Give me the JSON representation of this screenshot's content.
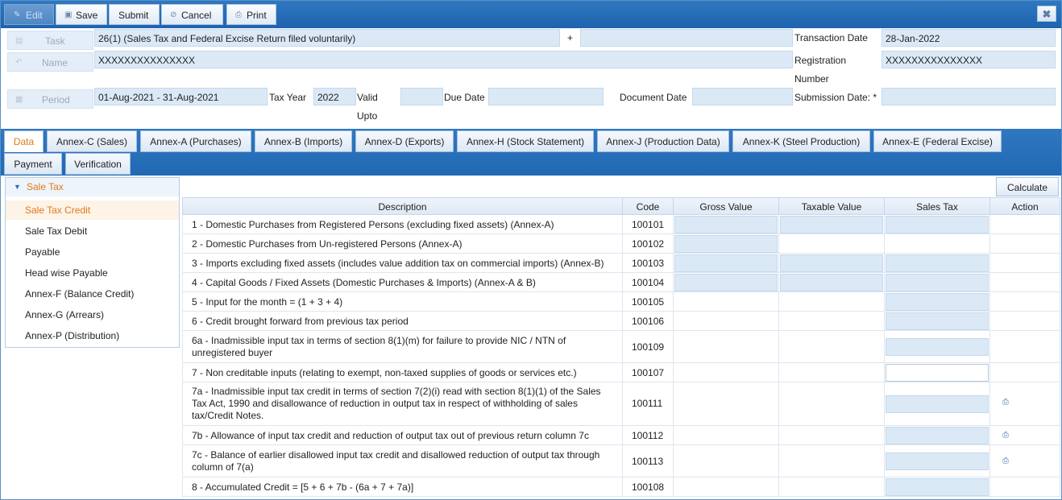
{
  "toolbar": {
    "edit_label": "Edit",
    "save_label": "Save",
    "submit_label": "Submit",
    "cancel_label": "Cancel",
    "print_label": "Print",
    "close_glyph": "✖"
  },
  "header": {
    "task_label": "Task",
    "task_value": "26(1) (Sales Tax and Federal Excise Return filed voluntarily)",
    "plus_glyph": "+",
    "name_label": "Name",
    "name_value": "XXXXXXXXXXXXXXX",
    "period_label": "Period",
    "period_value": "01-Aug-2021 -  31-Aug-2021",
    "tax_year_label": "Tax Year",
    "tax_year_value": "2022",
    "valid_label_line1": "Valid",
    "valid_label_line2": "Upto",
    "due_date_label": "Due Date",
    "document_date_label": "Document Date",
    "transaction_date_label": "Transaction Date",
    "transaction_date_value": "28-Jan-2022",
    "registration_label_line1": "Registration",
    "registration_label_line2": "Number",
    "registration_value": "XXXXXXXXXXXXXXX",
    "submission_date_label": "Submission Date: *"
  },
  "tabs_row1": [
    "Data",
    "Annex-C (Sales)",
    "Annex-A (Purchases)",
    "Annex-B (Imports)",
    "Annex-D (Exports)",
    "Annex-H (Stock Statement)",
    "Annex-J (Production Data)",
    "Annex-K (Steel Production)",
    "Annex-E (Federal Excise)"
  ],
  "tabs_row2": [
    "Payment",
    "Verification"
  ],
  "tree": {
    "root_label": "Sale Tax",
    "items": [
      "Sale Tax Credit",
      "Sale Tax Debit",
      "Payable",
      "Head wise Payable",
      "Annex-F (Balance Credit)",
      "Annex-G (Arrears)",
      "Annex-P (Distribution)"
    ]
  },
  "calculate_label": "Calculate",
  "grid": {
    "headers": [
      "Description",
      "Code",
      "Gross Value",
      "Taxable Value",
      "Sales Tax",
      "Action"
    ],
    "rows": [
      {
        "description": "1 - Domestic Purchases from Registered Persons (excluding fixed assets) (Annex-A)",
        "code": "100101"
      },
      {
        "description": "2 - Domestic Purchases from Un-registered Persons (Annex-A)",
        "code": "100102"
      },
      {
        "description": "3 - Imports excluding fixed assets (includes value addition tax on commercial imports) (Annex-B)",
        "code": "100103"
      },
      {
        "description": "4 - Capital Goods / Fixed Assets (Domestic Purchases & Imports) (Annex-A & B)",
        "code": "100104"
      },
      {
        "description": "5 - Input for the month = (1 + 3 + 4)",
        "code": "100105"
      },
      {
        "description": "6 - Credit brought forward from previous tax period",
        "code": "100106"
      },
      {
        "description": "6a - Inadmissible input tax in terms of section 8(1)(m) for failure to provide NIC / NTN of unregistered buyer",
        "code": "100109"
      },
      {
        "description": "7 - Non creditable inputs (relating to exempt, non-taxed supplies of goods or services etc.)",
        "code": "100107"
      },
      {
        "description": "7a - Inadmissible input tax credit in terms of section 7(2)(i) read with section 8(1)(1) of the Sales Tax Act, 1990 and disallowance of reduction in output tax in respect of withholding of sales tax/Credit Notes.",
        "code": "100111"
      },
      {
        "description": "7b - Allowance of input tax credit and reduction of output tax out of previous return column 7c",
        "code": "100112"
      },
      {
        "description": "7c - Balance of earlier disallowed input tax credit and disallowed reduction of output tax through column of 7(a)",
        "code": "100113"
      },
      {
        "description": "8 - Accumulated Credit = [5 + 6 + 7b - (6a + 7 + 7a)]",
        "code": "100108"
      }
    ]
  },
  "icons": {
    "edit": "pencil-icon",
    "save": "floppy-disk-icon",
    "cancel": "cancel-circle-icon",
    "print": "printer-icon",
    "task": "task-icon",
    "name": "user-back-icon",
    "period": "calendar-icon",
    "action": "printer-icon"
  },
  "colors": {
    "toolbar_blue": "#1d63ad",
    "active_orange": "#e07a1a",
    "field_blue": "#dbe9f7"
  }
}
